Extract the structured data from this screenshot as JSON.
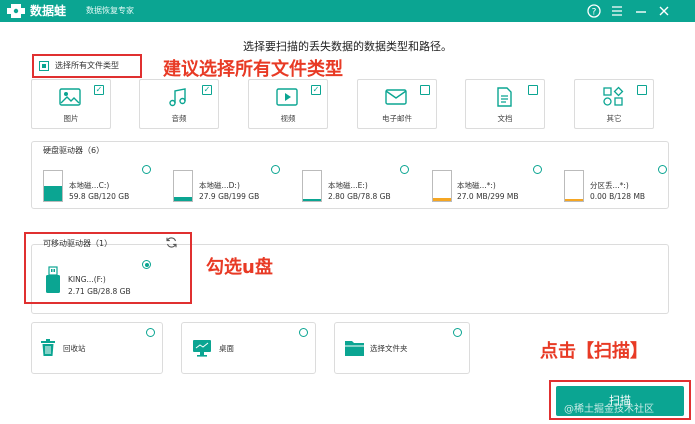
{
  "window": {
    "app_name": "数据蛙",
    "app_subtitle": "数据恢复专家",
    "help_icon": "help-icon",
    "menu_icon": "menu-icon",
    "minimize_icon": "minimize-icon",
    "close_icon": "close-icon"
  },
  "instruction": "选择要扫描的丢失数据的数据类型和路径。",
  "select_all_label": "选择所有文件类型",
  "annotations": {
    "select_all_tip": "建议选择所有文件类型",
    "select_usb_tip": "勾选u盘",
    "click_scan_tip": "点击【扫描】"
  },
  "file_types": [
    {
      "label": "图片",
      "icon": "image-icon",
      "checked": true
    },
    {
      "label": "音频",
      "icon": "audio-icon",
      "checked": true
    },
    {
      "label": "视频",
      "icon": "video-icon",
      "checked": true
    },
    {
      "label": "电子邮件",
      "icon": "email-icon",
      "checked": false
    },
    {
      "label": "文档",
      "icon": "document-icon",
      "checked": false
    },
    {
      "label": "其它",
      "icon": "other-icon",
      "checked": false
    }
  ],
  "hard_drives": {
    "title": "硬盘驱动器（6）",
    "drives": [
      {
        "name": "本地磁...C:)",
        "size": "59.8 GB/120 GB",
        "selected": false,
        "usage": 0.5,
        "fill_color": "#0ba592"
      },
      {
        "name": "本地磁...D:)",
        "size": "27.9 GB/199 GB",
        "selected": false,
        "usage": 0.14,
        "fill_color": "#0ba592"
      },
      {
        "name": "本地磁...E:)",
        "size": "2.80 GB/78.8 GB",
        "selected": false,
        "usage": 0.04,
        "fill_color": "#0ba592"
      },
      {
        "name": "本地磁...*:)",
        "size": "27.0 MB/299 MB",
        "selected": false,
        "usage": 0.09,
        "fill_color": "#f5a623"
      },
      {
        "name": "分区丢...*:)",
        "size": "0.00  B/128 MB",
        "selected": false,
        "usage": 0.0,
        "fill_color": "#f5a623"
      }
    ]
  },
  "removable": {
    "title": "可移动驱动器（1）",
    "refresh_icon": "refresh-icon",
    "drive": {
      "name": "KING...(F:)",
      "size": "2.71 GB/28.8 GB",
      "selected": true,
      "icon": "usb-drive-icon"
    }
  },
  "locations": [
    {
      "label": "回收站",
      "icon": "recycle-bin-icon"
    },
    {
      "label": "桌面",
      "icon": "desktop-icon"
    },
    {
      "label": "选择文件夹",
      "icon": "folder-icon"
    }
  ],
  "scan_button": "扫描",
  "watermark": "@稀土掘金技术社区",
  "colors": {
    "accent": "#0ba592",
    "annotation_red": "#e03030",
    "orange": "#f5a623"
  }
}
